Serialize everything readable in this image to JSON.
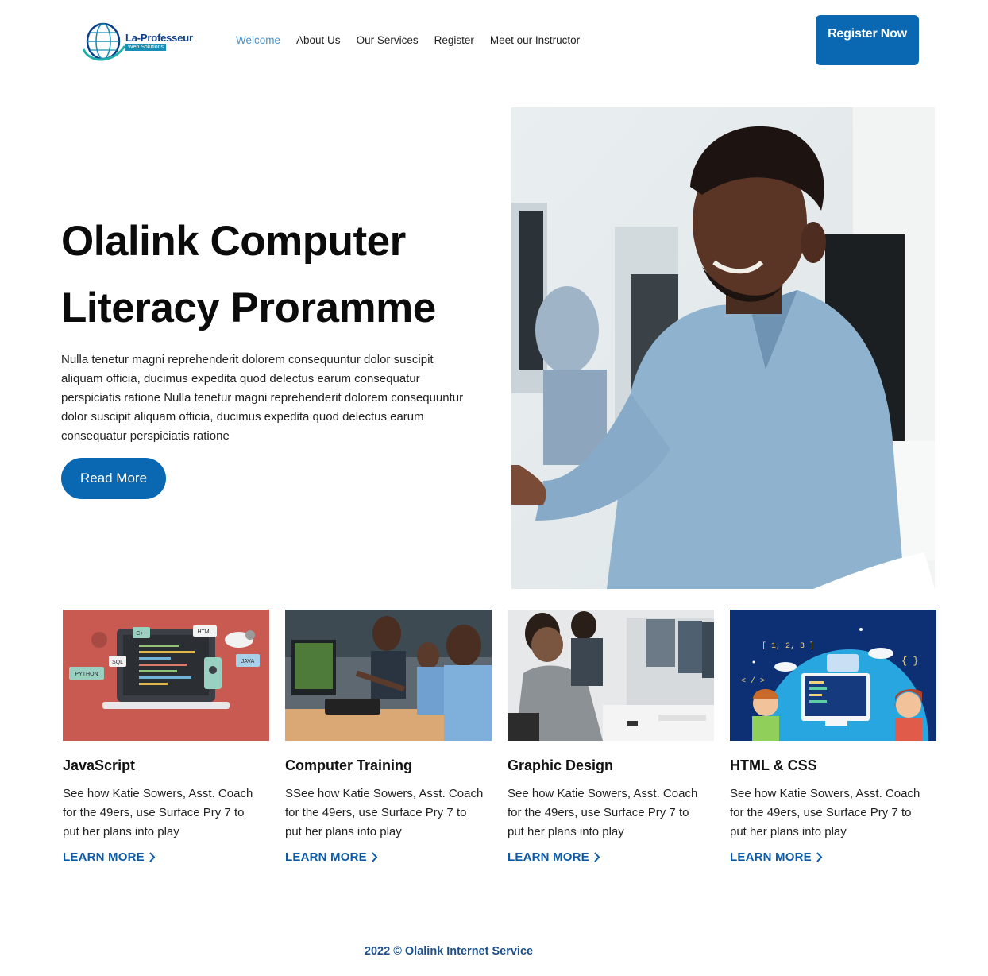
{
  "logo": {
    "name": "La-Professeur",
    "tagline": "Web Solutions"
  },
  "nav": {
    "items": [
      {
        "label": "Welcome",
        "active": true
      },
      {
        "label": "About Us",
        "active": false
      },
      {
        "label": "Our Services",
        "active": false
      },
      {
        "label": "Register",
        "active": false
      },
      {
        "label": "Meet our Instructor",
        "active": false
      }
    ]
  },
  "header": {
    "register_label": "Register Now"
  },
  "hero": {
    "title_line1": "Olalink Computer",
    "title_line2": "Literacy Proramme",
    "text": "Nulla tenetur magni reprehenderit dolorem consequuntur dolor suscipit aliquam officia, ducimus expedita quod delectus earum consequatur perspiciatis ratione Nulla tenetur magni reprehenderit dolorem consequuntur dolor suscipit aliquam officia, ducimus expedita quod delectus earum consequatur perspiciatis ratione",
    "read_more_label": "Read More"
  },
  "cards": [
    {
      "title": "JavaScript",
      "text": "See how Katie Sowers, Asst. Coach for the 49ers, use Surface Pry 7 to put her plans into play",
      "link": "LEARN MORE"
    },
    {
      "title": "Computer Training",
      "text": "SSee how Katie Sowers, Asst. Coach for the 49ers, use Surface Pry 7 to put her plans into play",
      "link": "LEARN MORE"
    },
    {
      "title": "Graphic Design",
      "text": "See how Katie Sowers, Asst. Coach for the 49ers, use Surface Pry 7 to put her plans into play",
      "link": "LEARN MORE"
    },
    {
      "title": "HTML & CSS",
      "text": "See how Katie Sowers, Asst. Coach for the 49ers, use Surface Pry 7 to put her plans into play",
      "link": "LEARN MORE"
    }
  ],
  "thumb_labels": {
    "c_plus": "C++",
    "html": "HTML",
    "sql": "SQL",
    "python": "PYTHON",
    "java": "JAVA",
    "array": "[ 1, 2, 3 ]",
    "tag": "< / >",
    "braces": "{  }"
  },
  "footer": {
    "text": "2022 © Olalink Internet Service"
  },
  "colors": {
    "primary": "#0a67b1",
    "nav_active": "#4a90c6",
    "link": "#0a5aa8",
    "footer": "#1c4f8a",
    "card1_bg": "#c85a52",
    "card4_bg": "#0d2f73"
  }
}
